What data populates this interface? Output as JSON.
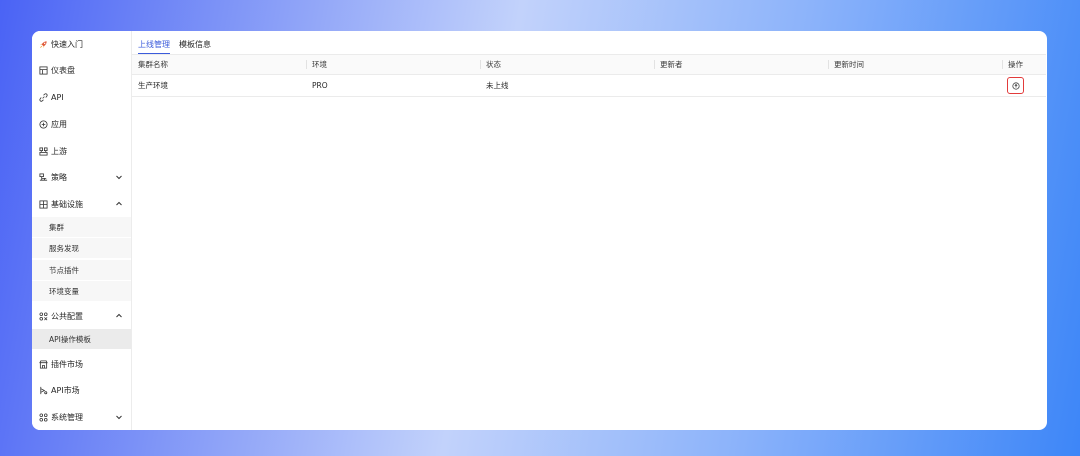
{
  "sidebar": {
    "items": [
      {
        "label": "快速入门",
        "icon": "rocket-icon"
      },
      {
        "label": "仪表盘",
        "icon": "dashboard-icon"
      },
      {
        "label": "API",
        "icon": "link-icon"
      },
      {
        "label": "应用",
        "icon": "app-icon"
      },
      {
        "label": "上游",
        "icon": "upstream-icon"
      },
      {
        "label": "策略",
        "icon": "policy-icon"
      },
      {
        "label": "基础设施",
        "icon": "infrastructure-icon"
      },
      {
        "label": "公共配置",
        "icon": "config-icon"
      },
      {
        "label": "插件市场",
        "icon": "store-icon"
      },
      {
        "label": "API市场",
        "icon": "api-market-icon"
      },
      {
        "label": "系统管理",
        "icon": "system-icon"
      }
    ],
    "infra_sub": [
      "集群",
      "服务发现",
      "节点插件",
      "环境变量"
    ],
    "config_sub": [
      "API操作模板"
    ]
  },
  "tabs": [
    {
      "label": "上线管理",
      "active": true
    },
    {
      "label": "模板信息",
      "active": false
    }
  ],
  "table": {
    "headers": [
      "集群名称",
      "环境",
      "状态",
      "更新者",
      "更新时间",
      "操作"
    ],
    "rows": [
      {
        "name": "生产环境",
        "env": "PRO",
        "status": "未上线",
        "updater": "",
        "updated_at": ""
      }
    ]
  },
  "colors": {
    "accent": "#3b5bdb",
    "highlight": "#e23b3b"
  }
}
